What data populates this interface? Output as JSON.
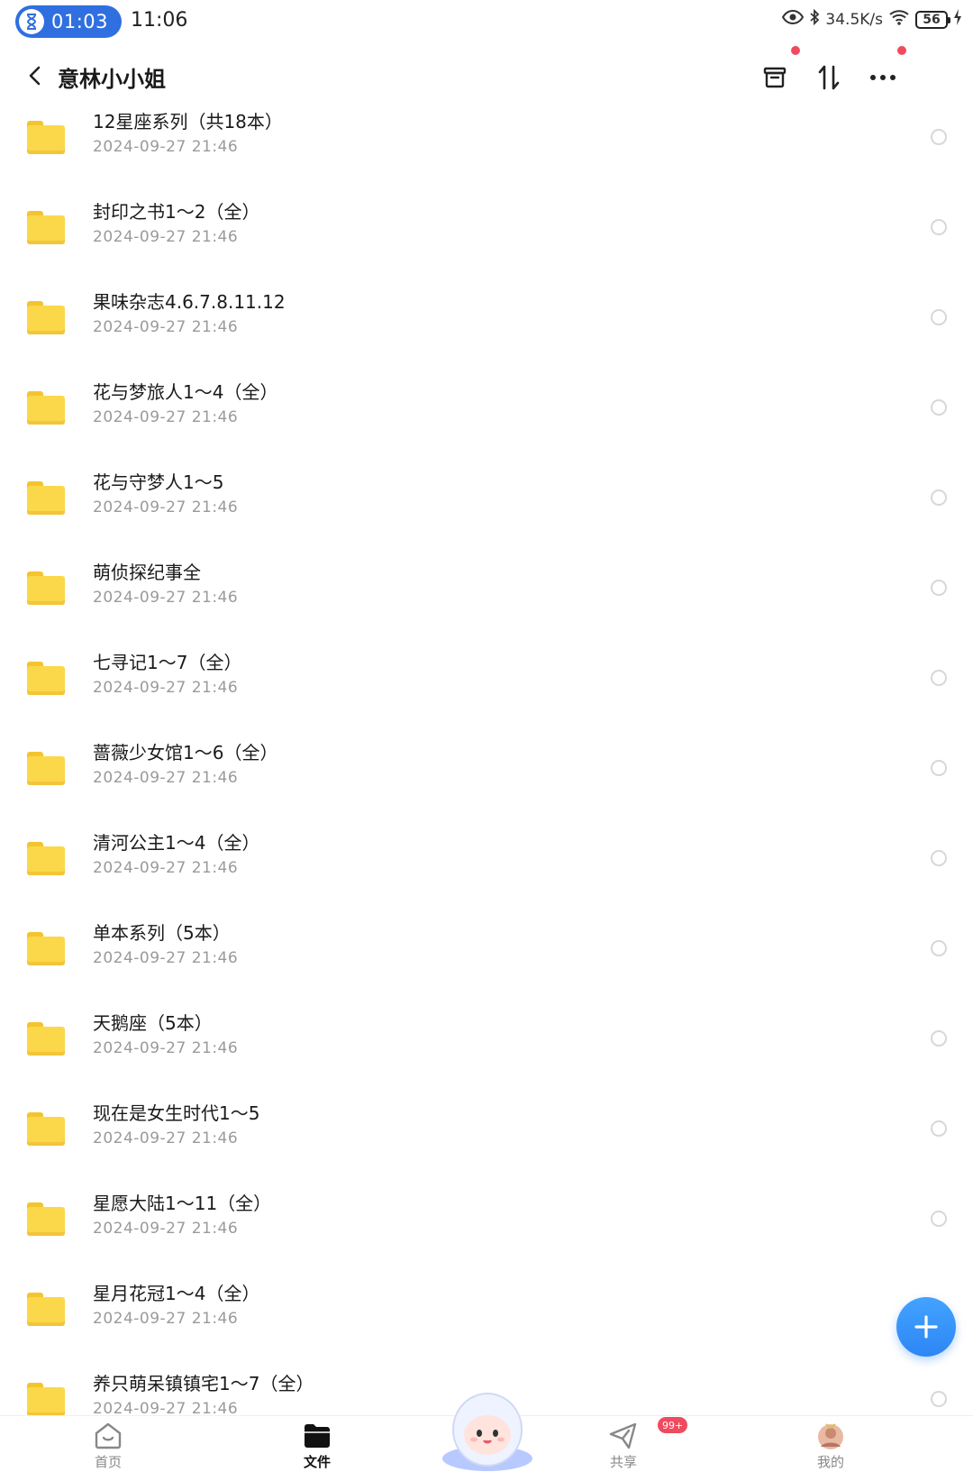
{
  "status_bar": {
    "timer": "01:03",
    "clock": "11:06",
    "net_speed": "34.5K/s",
    "battery": "56"
  },
  "header": {
    "title": "意林小小姐"
  },
  "files": [
    {
      "name": "12星座系列（共18本）",
      "date": "2024-09-27  21:46"
    },
    {
      "name": "封印之书1～2（全）",
      "date": "2024-09-27  21:46"
    },
    {
      "name": "果味杂志4.6.7.8.11.12",
      "date": "2024-09-27  21:46"
    },
    {
      "name": "花与梦旅人1～4（全）",
      "date": "2024-09-27  21:46"
    },
    {
      "name": "花与守梦人1～5",
      "date": "2024-09-27  21:46"
    },
    {
      "name": "萌侦探纪事全",
      "date": "2024-09-27  21:46"
    },
    {
      "name": "七寻记1～7（全）",
      "date": "2024-09-27  21:46"
    },
    {
      "name": "蔷薇少女馆1～6（全）",
      "date": "2024-09-27  21:46"
    },
    {
      "name": "清河公主1～4（全）",
      "date": "2024-09-27  21:46"
    },
    {
      "name": "单本系列（5本）",
      "date": "2024-09-27  21:46"
    },
    {
      "name": "天鹅座（5本）",
      "date": "2024-09-27  21:46"
    },
    {
      "name": "现在是女生时代1～5",
      "date": "2024-09-27  21:46"
    },
    {
      "name": "星愿大陆1～11（全）",
      "date": "2024-09-27  21:46"
    },
    {
      "name": "星月花冠1～4（全）",
      "date": "2024-09-27  21:46"
    },
    {
      "name": "养只萌呆镇镇宅1～7（全）",
      "date": "2024-09-27  21:46"
    }
  ],
  "bottom_nav": {
    "home": "首页",
    "files": "文件",
    "share": "共享",
    "mine": "我的",
    "share_badge": "99+"
  },
  "colors": {
    "accent": "#2f86f5",
    "folder": "#fbd84a",
    "badge": "#ef4b5f",
    "date_text": "#9a9a9a"
  },
  "icons": [
    "hourglass-icon",
    "eye-icon",
    "bluetooth-icon",
    "wifi-icon",
    "back-icon",
    "archive-icon",
    "sort-icon",
    "more-icon",
    "folder-icon",
    "plus-icon",
    "home-icon",
    "files-icon",
    "share-icon",
    "avatar"
  ]
}
